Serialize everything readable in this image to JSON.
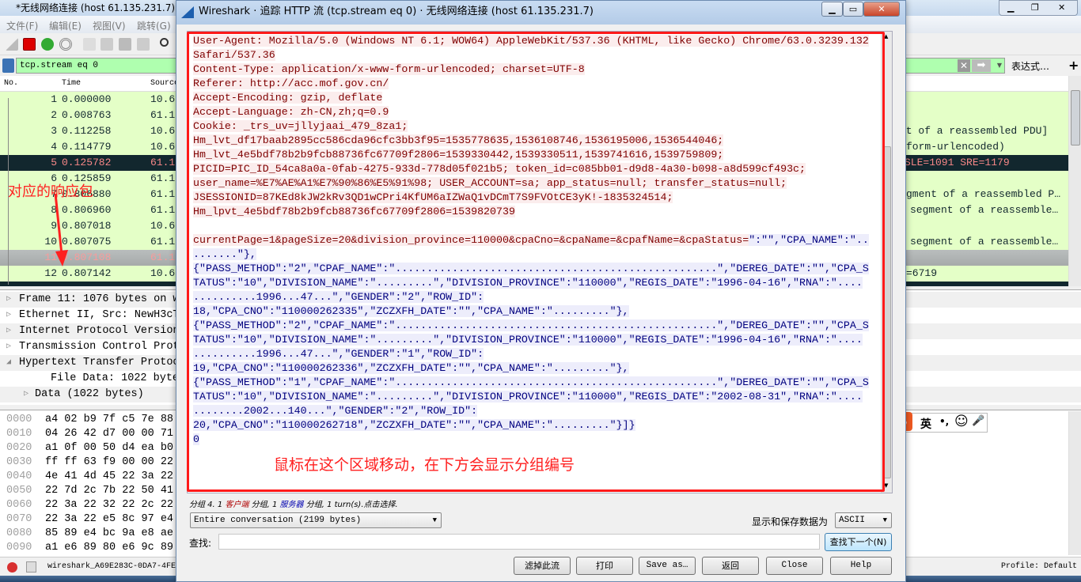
{
  "main_window": {
    "title": "*无线网络连接 (host 61.135.231.7)",
    "menu": [
      "文件(F)",
      "编辑(E)",
      "视图(V)",
      "跳转(G)"
    ],
    "filter": {
      "value": "tcp.stream eq 0",
      "expression_label": "表达式…",
      "add_label": "+"
    },
    "columns": [
      "No.",
      "Time",
      "Source"
    ],
    "packets": [
      {
        "no": "1",
        "time": "0.000000",
        "source": "10.6",
        "info": "",
        "style": "normal"
      },
      {
        "no": "2",
        "time": "0.008763",
        "source": "61.1",
        "info": "",
        "style": "normal"
      },
      {
        "no": "3",
        "time": "0.112258",
        "source": "10.6",
        "info": "nt of a reassembled PDU]",
        "style": "normal"
      },
      {
        "no": "4",
        "time": "0.114779",
        "source": "10.6",
        "info": "form-urlencoded)",
        "style": "normal"
      },
      {
        "no": "5",
        "time": "0.125782",
        "source": "61.1",
        "info": "SLE=1091 SRE=1179",
        "style": "dark"
      },
      {
        "no": "6",
        "time": "0.125859",
        "source": "61.1",
        "info": "",
        "style": "normal"
      },
      {
        "no": "7",
        "time": "0.806880",
        "source": "61.1",
        "info": "gment of a reassembled P…",
        "style": "normal"
      },
      {
        "no": "8",
        "time": "0.806960",
        "source": "61.1",
        "info": "segment of a reassemble…",
        "style": "normal"
      },
      {
        "no": "9",
        "time": "0.807018",
        "source": "10.6",
        "info": "",
        "style": "normal"
      },
      {
        "no": "10",
        "time": "0.807075",
        "source": "61.1",
        "info": "segment of a reassemble…",
        "style": "normal"
      },
      {
        "no": "11",
        "time": "0.807108",
        "source": "61.1",
        "info": "",
        "style": "selected"
      },
      {
        "no": "12",
        "time": "0.807142",
        "source": "10.6",
        "info": "=6719",
        "style": "normal"
      }
    ],
    "details": [
      {
        "text": "Frame 11: 1076 bytes on w",
        "expander": "▷",
        "indent": 0
      },
      {
        "text": "Ethernet II, Src: NewH3cT",
        "expander": "▷",
        "indent": 0
      },
      {
        "text": "Internet Protocol Version",
        "expander": "▷",
        "indent": 0
      },
      {
        "text": "Transmission Control Prot",
        "expander": "▷",
        "indent": 0,
        "highlight": true
      },
      {
        "text": "Hypertext Transfer Protoc",
        "expander": "◢",
        "indent": 0
      },
      {
        "text": "File Data: 1022 bytes",
        "expander": "",
        "indent": 2
      },
      {
        "text": "Data (1022 bytes)",
        "expander": "▷",
        "indent": 1
      }
    ],
    "hex": [
      {
        "offset": "0000",
        "bytes": "a4 02 b9 7f c5 7e 88"
      },
      {
        "offset": "0010",
        "bytes": "04 26 42 d7 00 00 71"
      },
      {
        "offset": "0020",
        "bytes": "a1 0f 00 50 d4 ea b0"
      },
      {
        "offset": "0030",
        "bytes": "ff ff 63 f9 00 00 22"
      },
      {
        "offset": "0040",
        "bytes": "4e 41 4d 45 22 3a 22"
      },
      {
        "offset": "0050",
        "bytes": "22 7d 2c 7b 22 50 41"
      },
      {
        "offset": "0060",
        "bytes": "22 3a 22 32 22 2c 22"
      },
      {
        "offset": "0070",
        "bytes": "22 3a 22 e5 8c 97 e4"
      },
      {
        "offset": "0080",
        "bytes": "85 89 e4 bc 9a e8 ae"
      },
      {
        "offset": "0090",
        "bytes": "a1 e6 89 80 e6 9c 89"
      }
    ],
    "status": {
      "file": "wireshark_A69E283C-0DA7-4FE",
      "profile": "Profile: Default"
    },
    "annotation": "对应的响应包"
  },
  "ime": {
    "mode": "英",
    "punct": "•,",
    "emoji": "☺",
    "mic": "🎤"
  },
  "dialog": {
    "title": "Wireshark · 追踪 HTTP 流 (tcp.stream eq 0) · 无线网络连接 (host 61.135.231.7)",
    "window_buttons": [
      "▁",
      "▭",
      "✕"
    ],
    "stream_lines": [
      [
        {
          "side": "client",
          "text": "User-Agent: Mozilla/5.0 (Windows NT 6.1; WOW64) AppleWebKit/537.36 (KHTML, like Gecko) Chrome/63.0.3239.132"
        }
      ],
      [
        {
          "side": "client",
          "text": "Safari/537.36"
        }
      ],
      [
        {
          "side": "client",
          "text": "Content-Type: application/x-www-form-urlencoded; charset=UTF-8"
        }
      ],
      [
        {
          "side": "client",
          "text": "Referer: http://acc.mof.gov.cn/"
        }
      ],
      [
        {
          "side": "client",
          "text": "Accept-Encoding: gzip, deflate"
        }
      ],
      [
        {
          "side": "client",
          "text": "Accept-Language: zh-CN,zh;q=0.9"
        }
      ],
      [
        {
          "side": "client",
          "text": "Cookie: _trs_uv=jllyjaai_479_8za1;"
        }
      ],
      [
        {
          "side": "client",
          "text": "Hm_lvt_df17baab2895cc586cda96cfc3bb3f95=1535778635,1536108746,1536195006,1536544046;"
        }
      ],
      [
        {
          "side": "client",
          "text": "Hm_lvt_4e5bdf78b2b9fcb88736fc67709f2806=1539330442,1539330511,1539741616,1539759809;"
        }
      ],
      [
        {
          "side": "client",
          "text": "PICID=PIC_ID_54ca8a0a-0fab-4275-933d-778d05f021b5; token_id=c085bb01-d9d8-4a30-b098-a8d599cf493c;"
        }
      ],
      [
        {
          "side": "client",
          "text": "user_name=%E7%AE%A1%E7%90%86%E5%91%98; USER_ACCOUNT=sa; app_status=null; transfer_status=null;"
        }
      ],
      [
        {
          "side": "client",
          "text": "JSESSIONID=87KEd8kJW2kRv3QD1wCPri4KfUM6aIZWaQ1vDCmT7S9FVOtCE3yK!-1835324514;"
        }
      ],
      [
        {
          "side": "client",
          "text": "Hm_lpvt_4e5bdf78b2b9fcb88736fc67709f2806=1539820739"
        }
      ],
      [
        {
          "side": "client",
          "text": ""
        }
      ],
      [
        {
          "side": "client",
          "text": "currentPage=1&pageSize=20&division_province=110000&cpaCno=&cpaName=&cpafName=&cpaStatus="
        },
        {
          "side": "server",
          "text": "\":\"\",\"CPA_NAME\":\".."
        }
      ],
      [
        {
          "side": "server",
          "text": ".......\"},"
        }
      ],
      [
        {
          "side": "server",
          "text": "{\"PASS_METHOD\":\"2\",\"CPAF_NAME\":\"...................................................\",\"DEREG_DATE\":\"\",\"CPA_S"
        }
      ],
      [
        {
          "side": "server",
          "text": "TATUS\":\"10\",\"DIVISION_NAME\":\".........\",\"DIVISION_PROVINCE\":\"110000\",\"REGIS_DATE\":\"1996-04-16\",\"RNA\":\"...."
        }
      ],
      [
        {
          "side": "server",
          "text": "..........1996...47...\",\"GENDER\":\"2\",\"ROW_ID\":"
        }
      ],
      [
        {
          "side": "server",
          "text": "18,\"CPA_CNO\":\"110000262335\",\"ZCZXFH_DATE\":\"\",\"CPA_NAME\":\".........\"},"
        }
      ],
      [
        {
          "side": "server",
          "text": "{\"PASS_METHOD\":\"2\",\"CPAF_NAME\":\"...................................................\",\"DEREG_DATE\":\"\",\"CPA_S"
        }
      ],
      [
        {
          "side": "server",
          "text": "TATUS\":\"10\",\"DIVISION_NAME\":\".........\",\"DIVISION_PROVINCE\":\"110000\",\"REGIS_DATE\":\"1996-04-16\",\"RNA\":\"...."
        }
      ],
      [
        {
          "side": "server",
          "text": "..........1996...47...\",\"GENDER\":\"1\",\"ROW_ID\":"
        }
      ],
      [
        {
          "side": "server",
          "text": "19,\"CPA_CNO\":\"110000262336\",\"ZCZXFH_DATE\":\"\",\"CPA_NAME\":\".........\"},"
        }
      ],
      [
        {
          "side": "server",
          "text": "{\"PASS_METHOD\":\"1\",\"CPAF_NAME\":\"...................................................\",\"DEREG_DATE\":\"\",\"CPA_S"
        }
      ],
      [
        {
          "side": "server",
          "text": "TATUS\":\"10\",\"DIVISION_NAME\":\".........\",\"DIVISION_PROVINCE\":\"110000\",\"REGIS_DATE\":\"2002-08-31\",\"RNA\":\"...."
        }
      ],
      [
        {
          "side": "server",
          "text": "........2002...140...\",\"GENDER\":\"2\",\"ROW_ID\":"
        }
      ],
      [
        {
          "side": "server",
          "text": "20,\"CPA_CNO\":\"110000262718\",\"ZCZXFH_DATE\":\"\",\"CPA_NAME\":\".........\"}]}"
        }
      ],
      [
        {
          "side": "server",
          "text": "0"
        }
      ]
    ],
    "annotation": "鼠标在这个区域移动，在下方会显示分组编号",
    "status": {
      "prefix": "分组 4. 1 ",
      "client": "客户端",
      "mid": " 分组, 1 ",
      "server": "服务器",
      "suffix": " 分组, 1 turn(s).点击选择."
    },
    "colors": {
      "client_fg": "#7f0000",
      "client_bg": "#fbeded",
      "server_fg": "#00007f",
      "server_bg": "#ededfb",
      "annotation": "#ff2020"
    },
    "conversation_select": "Entire conversation (2199 bytes)",
    "show_as_label": "显示和保存数据为",
    "show_as_value": "ASCII",
    "find_label": "查找:",
    "find_value": "",
    "find_next": "查找下一个(N)",
    "buttons": {
      "filter_out": "滤掉此流",
      "print": "打印",
      "save_as": "Save as…",
      "back": "返回",
      "close": "Close",
      "help": "Help"
    }
  }
}
